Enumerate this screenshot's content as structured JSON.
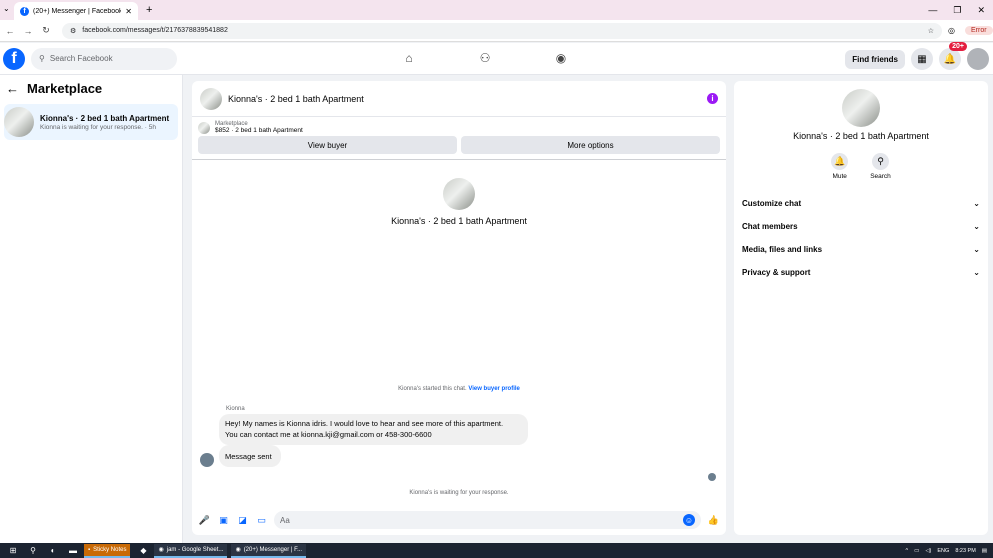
{
  "browser": {
    "tab_title": "(20+) Messenger | Facebook",
    "tab_icon": "facebook-icon",
    "new_tab": "+",
    "url": "facebook.com/messages/t/2176378839541882",
    "error_label": "Error"
  },
  "fb": {
    "logo": "f",
    "search_placeholder": "Search Facebook",
    "find_friends": "Find friends",
    "notif_badge": "20+"
  },
  "left": {
    "title": "Marketplace",
    "conversations": [
      {
        "name": "Kionna's · 2 bed 1 bath Apartment",
        "subtitle": "Kionna is waiting for your response. · 5h"
      }
    ]
  },
  "chat": {
    "title": "Kionna's · 2 bed 1 bath Apartment",
    "marketplace_label": "Marketplace",
    "listing": "$852 · 2 bed 1 bath Apartment",
    "view_buyer": "View buyer",
    "more_options": "More options",
    "center_name": "Kionna's · 2 bed 1 bath Apartment",
    "started_text": "Kionna's started this chat.",
    "view_buyer_profile": "View buyer profile",
    "sender": "Kionna",
    "message_line1": "Hey! My names is Kionna idris. I would love to hear and see more of this apartment.",
    "message_line2": "You can contact me at kionna.kji@gmail.com or 458-300-6600",
    "message_sent": "Message sent",
    "waiting": "Kionna's is waiting for your response.",
    "composer_placeholder": "Aa"
  },
  "right": {
    "name": "Kionna's · 2 bed 1 bath Apartment",
    "mute": "Mute",
    "search": "Search",
    "sections": [
      "Customize chat",
      "Chat members",
      "Media, files and links",
      "Privacy & support"
    ]
  },
  "taskbar": {
    "apps": [
      "Sticky Notes",
      "jam - Google Sheet...",
      "(20+) Messenger | F..."
    ],
    "lang": "ENG",
    "time": "8:23 PM"
  },
  "colors": {
    "fb_blue": "#0866ff",
    "badge_red": "#e41e3f",
    "info_purple": "#9b19f5"
  }
}
